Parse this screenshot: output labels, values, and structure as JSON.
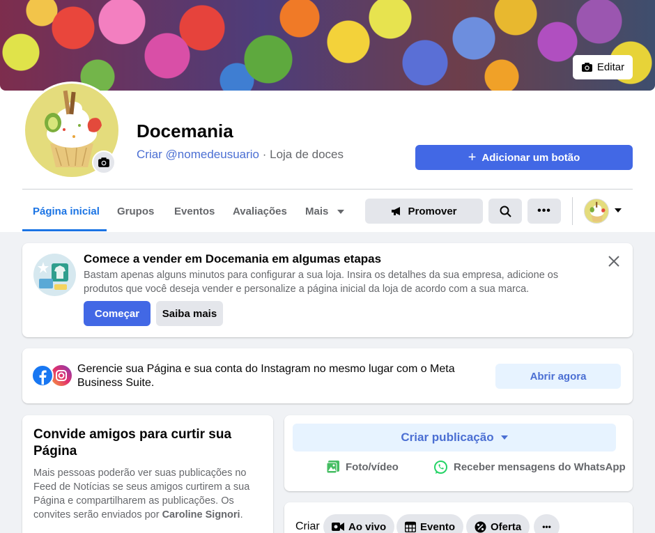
{
  "cover": {
    "edit_label": "Editar"
  },
  "page": {
    "name": "Docemania",
    "username_link": "Criar @nomedeusuario",
    "separator": " · ",
    "category": "Loja de doces",
    "add_button_label": "Adicionar um botão"
  },
  "nav": {
    "tabs": [
      {
        "label": "Página inicial",
        "active": true
      },
      {
        "label": "Grupos"
      },
      {
        "label": "Eventos"
      },
      {
        "label": "Avaliações"
      },
      {
        "label": "Mais"
      }
    ],
    "promote_label": "Promover"
  },
  "shop_card": {
    "title": "Comece a vender em Docemania em algumas etapas",
    "text": "Bastam apenas alguns minutos para configurar a sua loja. Insira os detalhes da sua empresa, adicione os produtos que você deseja vender e personalize a página inicial da loja de acordo com a sua marca.",
    "start_label": "Começar",
    "learn_label": "Saiba mais"
  },
  "meta_card": {
    "text": "Gerencie sua Página e sua conta do Instagram no mesmo lugar com o Meta Business Suite.",
    "button_label": "Abrir agora"
  },
  "invite_card": {
    "title": "Convide amigos para curtir sua Página",
    "text_before": "Mais pessoas poderão ver suas publicações no Feed de Notícias se seus amigos curtirem a sua Página e compartilharem as publicações. Os convites serão enviados por ",
    "sender": "Caroline Signori",
    "text_after": "."
  },
  "post_card": {
    "create_label": "Criar publicação",
    "photo_label": "Foto/vídeo",
    "whatsapp_label": "Receber mensagens do WhatsApp"
  },
  "create_bar": {
    "label": "Criar",
    "live_label": "Ao vivo",
    "event_label": "Evento",
    "offer_label": "Oferta"
  },
  "colors": {
    "accent": "#4268e5",
    "link": "#1b74e4",
    "background": "#f0f2f5"
  }
}
